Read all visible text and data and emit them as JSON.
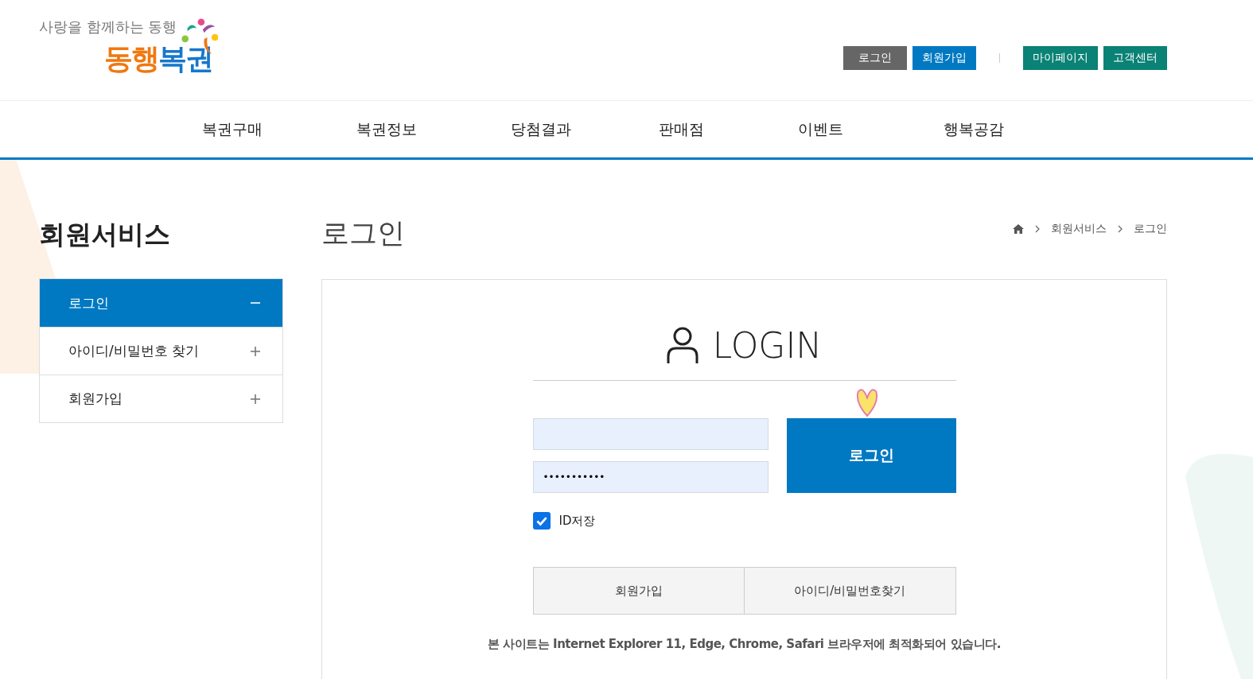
{
  "logo": {
    "tagline": "사랑을 함께하는 동행",
    "name": [
      {
        "text": "동행",
        "color": "#f0780f"
      },
      {
        "text": "복권",
        "color": "#1677cc"
      }
    ]
  },
  "top_links": [
    {
      "label": "로그인",
      "kind": "gray"
    },
    {
      "label": "회원가입",
      "kind": "blue"
    },
    {
      "label": "마이페이지",
      "kind": "teal"
    },
    {
      "label": "고객센터",
      "kind": "teal"
    }
  ],
  "nav": [
    "복권구매",
    "복권정보",
    "당첨결과",
    "판매점",
    "이벤트",
    "행복공감"
  ],
  "sidebar": {
    "title": "회원서비스",
    "items": [
      {
        "label": "로그인",
        "selected": true
      },
      {
        "label": "아이디/비밀번호 찾기",
        "selected": false
      },
      {
        "label": "회원가입",
        "selected": false
      }
    ]
  },
  "page_title": "로그인",
  "breadcrumb": [
    "회원서비스",
    "로그인"
  ],
  "login": {
    "heading": "LOGIN",
    "password_value": "•••••••••••",
    "button": "로그인",
    "remember": {
      "label": "ID저장",
      "checked": true
    },
    "links": [
      "회원가입",
      "아이디/비밀번호찾기"
    ],
    "notice": "본 사이트는 Internet Explorer 11, Edge, Chrome, Safari 브라우저에 최적화되어 있습니다."
  }
}
